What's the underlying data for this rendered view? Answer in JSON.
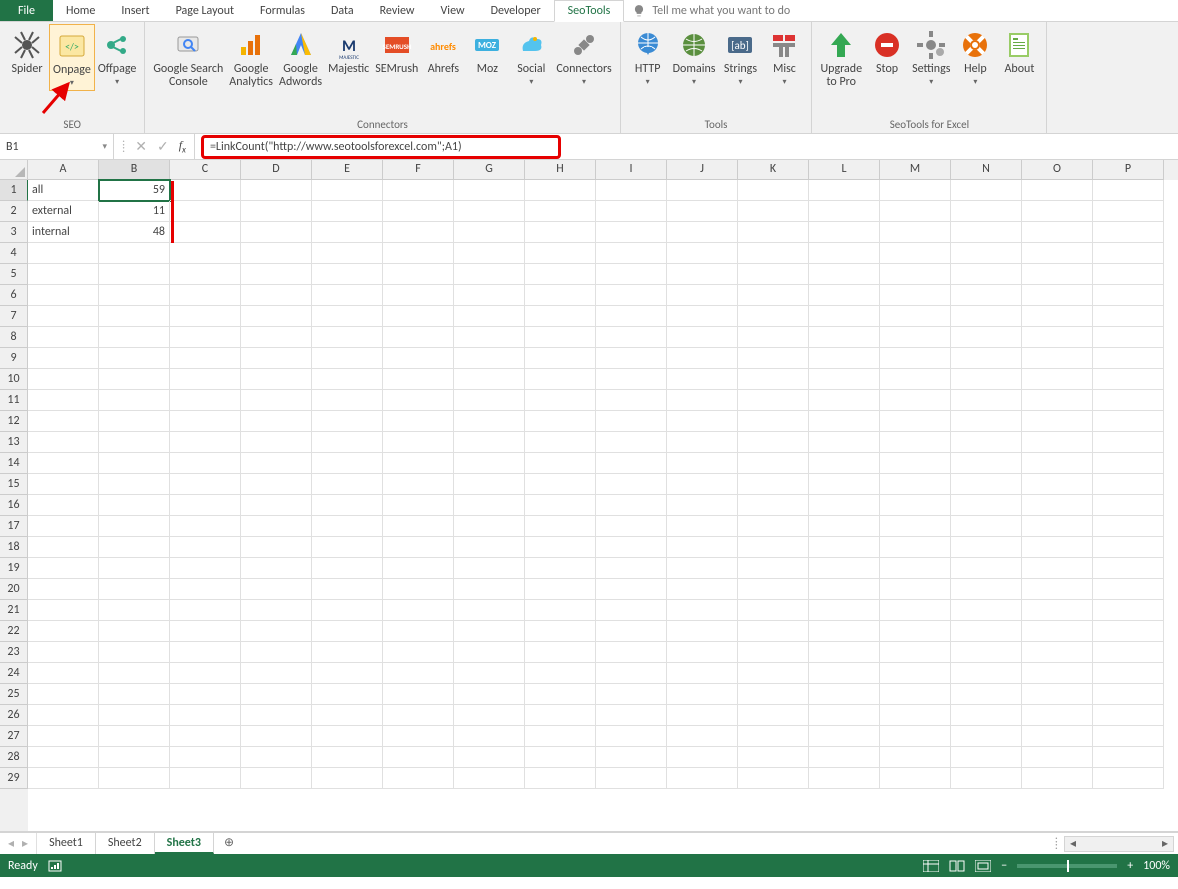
{
  "tabs": {
    "file": "File",
    "items": [
      "Home",
      "Insert",
      "Page Layout",
      "Formulas",
      "Data",
      "Review",
      "View",
      "Developer",
      "SeoTools"
    ],
    "active": "SeoTools",
    "tellme": "Tell me what you want to do"
  },
  "ribbon": {
    "groups": [
      {
        "label": "SEO",
        "items": [
          {
            "name": "spider",
            "label": "Spider",
            "drop": false,
            "icon": "spider"
          },
          {
            "name": "onpage",
            "label": "Onpage",
            "drop": true,
            "icon": "onpage",
            "hl": true
          },
          {
            "name": "offpage",
            "label": "Offpage",
            "drop": true,
            "icon": "offpage"
          }
        ]
      },
      {
        "label": "Connectors",
        "items": [
          {
            "name": "gsc",
            "label": "Google Search\nConsole",
            "icon": "gsc"
          },
          {
            "name": "ga",
            "label": "Google\nAnalytics",
            "icon": "ga"
          },
          {
            "name": "gaw",
            "label": "Google\nAdwords",
            "icon": "gaw"
          },
          {
            "name": "majestic",
            "label": "Majestic",
            "icon": "majestic"
          },
          {
            "name": "semrush",
            "label": "SEMrush",
            "icon": "semrush"
          },
          {
            "name": "ahrefs",
            "label": "Ahrefs",
            "icon": "ahrefs"
          },
          {
            "name": "moz",
            "label": "Moz",
            "icon": "moz"
          },
          {
            "name": "social",
            "label": "Social",
            "drop": true,
            "icon": "social"
          },
          {
            "name": "connectors",
            "label": "Connectors",
            "drop": true,
            "icon": "connectors"
          }
        ]
      },
      {
        "label": "Tools",
        "items": [
          {
            "name": "http",
            "label": "HTTP",
            "drop": true,
            "icon": "http"
          },
          {
            "name": "domains",
            "label": "Domains",
            "drop": true,
            "icon": "domains"
          },
          {
            "name": "strings",
            "label": "Strings",
            "drop": true,
            "icon": "strings"
          },
          {
            "name": "misc",
            "label": "Misc",
            "drop": true,
            "icon": "misc"
          }
        ]
      },
      {
        "label": "SeoTools for Excel",
        "items": [
          {
            "name": "upgrade",
            "label": "Upgrade\nto Pro",
            "icon": "upgrade"
          },
          {
            "name": "stop",
            "label": "Stop",
            "icon": "stop"
          },
          {
            "name": "settings",
            "label": "Settings",
            "drop": true,
            "icon": "settings"
          },
          {
            "name": "help",
            "label": "Help",
            "drop": true,
            "icon": "help"
          },
          {
            "name": "about",
            "label": "About",
            "icon": "about"
          }
        ]
      }
    ]
  },
  "namebox": "B1",
  "formula": "=LinkCount(\"http://www.seotoolsforexcel.com\";A1)",
  "columns": [
    "A",
    "B",
    "C",
    "D",
    "E",
    "F",
    "G",
    "H",
    "I",
    "J",
    "K",
    "L",
    "M",
    "N",
    "O",
    "P"
  ],
  "selectedCol": "B",
  "selectedRow": 1,
  "rowCount": 29,
  "data": {
    "rows": [
      {
        "a": "all",
        "b": "59"
      },
      {
        "a": "external",
        "b": "11"
      },
      {
        "a": "internal",
        "b": "48"
      }
    ]
  },
  "sheets": {
    "items": [
      "Sheet1",
      "Sheet2",
      "Sheet3"
    ],
    "active": "Sheet3"
  },
  "status": {
    "left": "Ready",
    "zoom": "100%"
  },
  "glyphs": {
    "plus": "+",
    "minus": "−",
    "caretLeft": "◂",
    "caretRight": "▸",
    "addCircle": "⊕",
    "dots": "⁞"
  }
}
